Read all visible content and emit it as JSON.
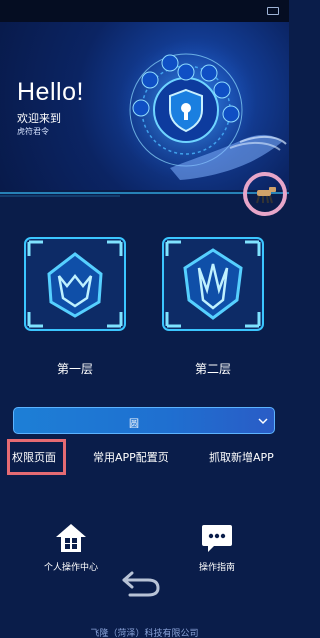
{
  "hero": {
    "title": "Hello!",
    "subtitle": "欢迎来到",
    "user": "虎符君令"
  },
  "layers": [
    {
      "label": "第一层"
    },
    {
      "label": "第二层"
    }
  ],
  "dropdown": {
    "value": "圆"
  },
  "nav": [
    {
      "label": "权限页面",
      "active": true
    },
    {
      "label": "常用APP配置页",
      "active": false
    },
    {
      "label": "抓取新增APP",
      "active": false
    }
  ],
  "bottom_actions": [
    {
      "label": "个人操作中心",
      "icon": "home-icon"
    },
    {
      "label": "操作指南",
      "icon": "chat-icon"
    }
  ],
  "footer": {
    "text": "飞隆（菏泽）科技有限公司"
  },
  "colors": {
    "background": "#0a1d4a",
    "accent": "#1d7fd6",
    "glow": "#3bc6ff",
    "highlight": "#e56b73"
  }
}
